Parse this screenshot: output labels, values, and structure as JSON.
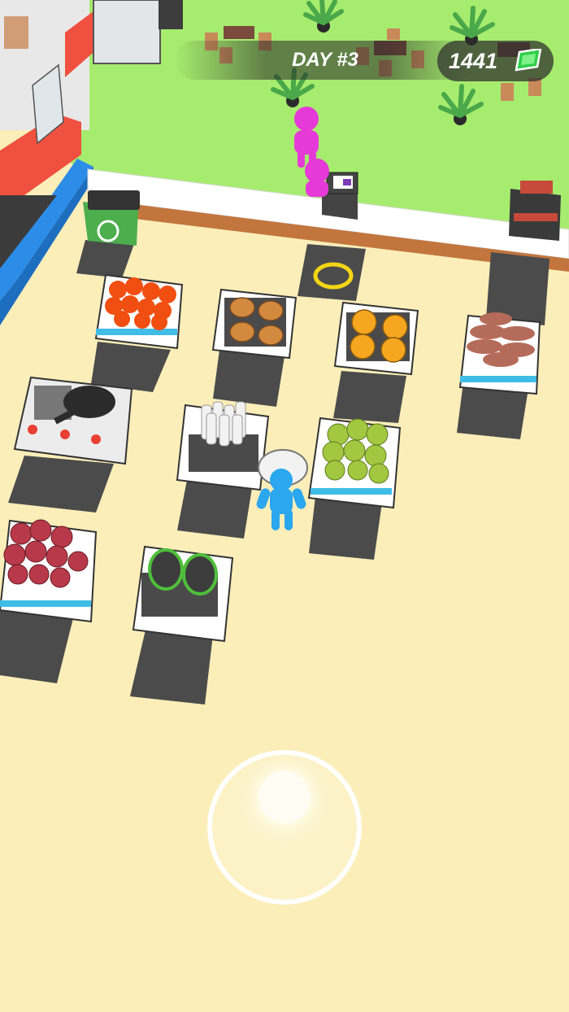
{
  "hud": {
    "day_label": "DAY #3",
    "money": "1441",
    "money_icon": "cash-icon"
  },
  "colors": {
    "floor": "#fbeeb9",
    "grass": "#a6ec6e",
    "player": "#2aa7ef",
    "customer": "#e63ad8",
    "counter": "#ffffff",
    "wall": "#f24b3b"
  },
  "stations": [
    {
      "name": "tomato-crate",
      "icon": "tomato-icon"
    },
    {
      "name": "bun-crate",
      "icon": "bun-icon"
    },
    {
      "name": "cheese-crate",
      "icon": "cheese-icon"
    },
    {
      "name": "meat-patty-crate",
      "icon": "patty-icon"
    },
    {
      "name": "stove-with-pan",
      "icon": "frying-pan-icon"
    },
    {
      "name": "sauce-bottle-station",
      "icon": "bottle-icon"
    },
    {
      "name": "lettuce-crate",
      "icon": "lettuce-icon"
    },
    {
      "name": "onion-crate",
      "icon": "onion-icon"
    },
    {
      "name": "pickle-crate",
      "icon": "pickle-icon"
    },
    {
      "name": "trash-bin",
      "icon": "recycle-icon"
    },
    {
      "name": "cash-register",
      "icon": "register-icon"
    },
    {
      "name": "drink-dispenser",
      "icon": "drink-icon"
    }
  ]
}
